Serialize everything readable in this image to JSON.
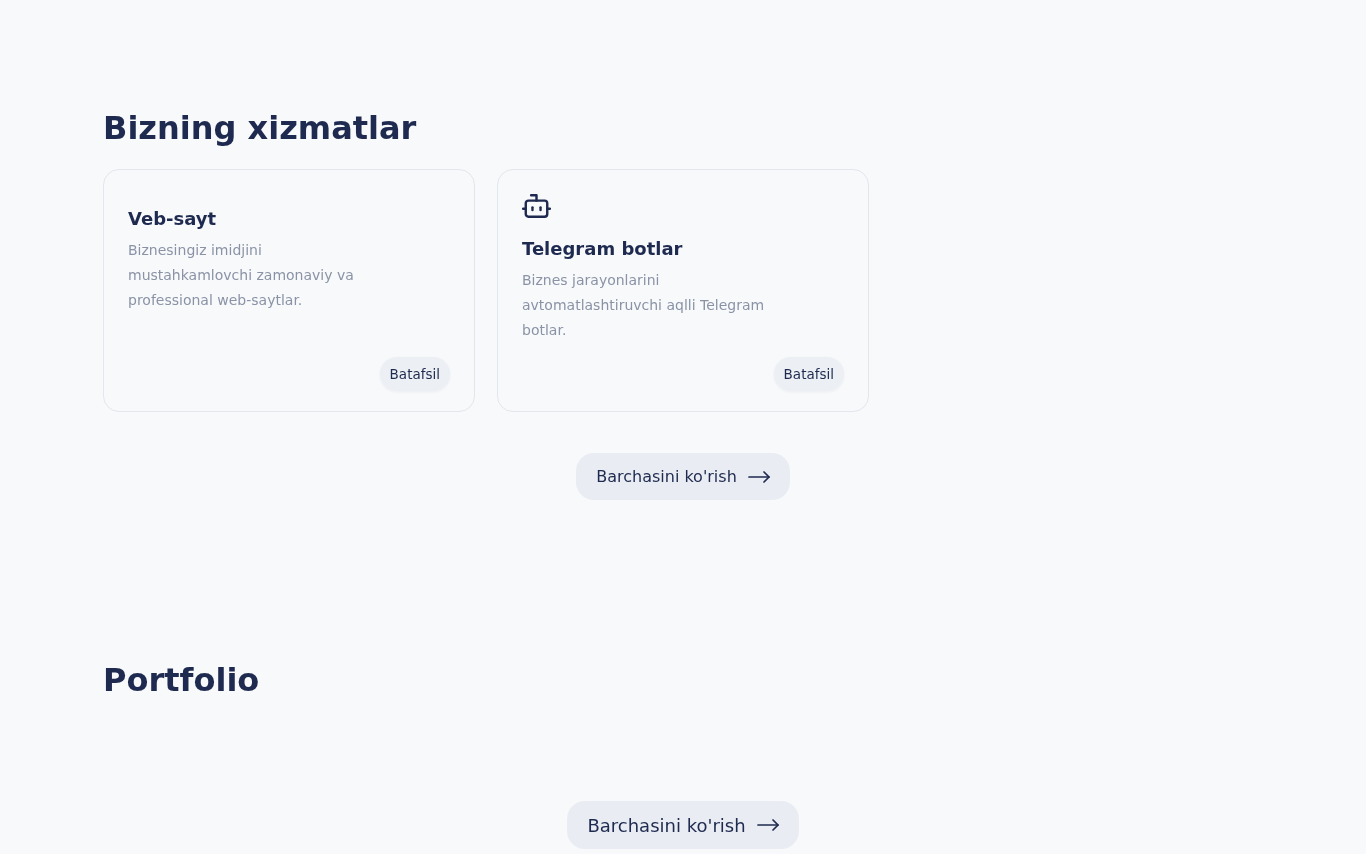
{
  "services": {
    "title": "Bizning xizmatlar",
    "cards": [
      {
        "kind": "plain",
        "title": "Veb-sayt",
        "description": "Biznesingiz imidjini mustahkamlovchi zamonaviy va professional web-saytlar.",
        "button": "Batafsil"
      },
      {
        "kind": "robot",
        "title": "Telegram botlar",
        "description": "Biznes jarayonlarini avtomatlashtiruvchi aqlli Telegram botlar.",
        "button": "Batafsil"
      }
    ],
    "view_all_button": {
      "kind": "regular",
      "label": "Barchasini ko'rish"
    }
  },
  "portfolio": {
    "title": "Portfolio",
    "view_all_button": {
      "kind": "large",
      "label": "Barchasini ko'rish"
    }
  }
}
